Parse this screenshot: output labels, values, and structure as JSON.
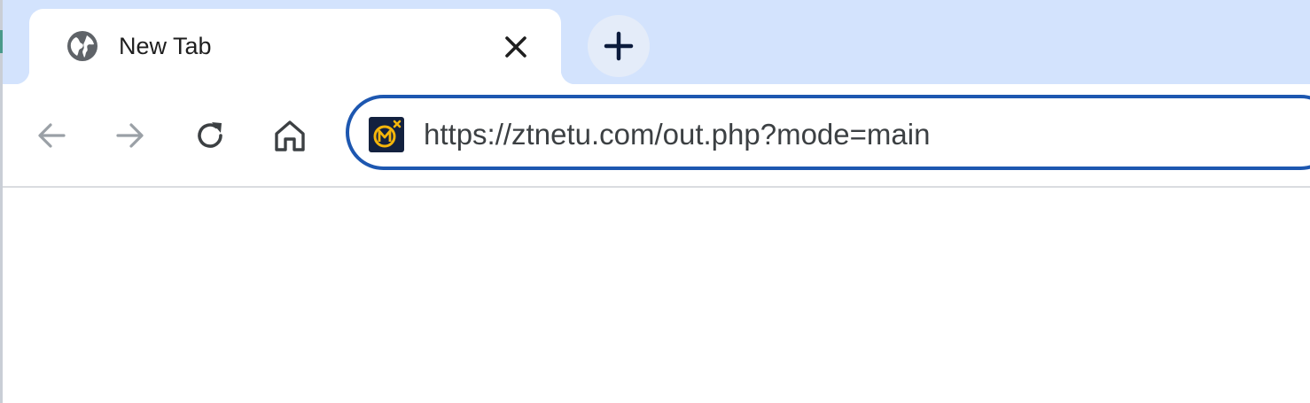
{
  "tabs": [
    {
      "title": "New Tab",
      "favicon": "globe-icon",
      "active": true
    }
  ],
  "toolbar": {
    "back_icon": "arrow-back-icon",
    "forward_icon": "arrow-forward-icon",
    "reload_icon": "reload-icon",
    "home_icon": "home-icon"
  },
  "omnibox": {
    "url": "https://ztnetu.com/out.php?mode=main",
    "site_favicon": "site-logo-icon"
  },
  "colors": {
    "tabstrip_bg": "#d3e3fd",
    "focus_ring": "#1d57b0",
    "favicon_bg": "#13213f",
    "favicon_accent": "#f5b50a"
  }
}
